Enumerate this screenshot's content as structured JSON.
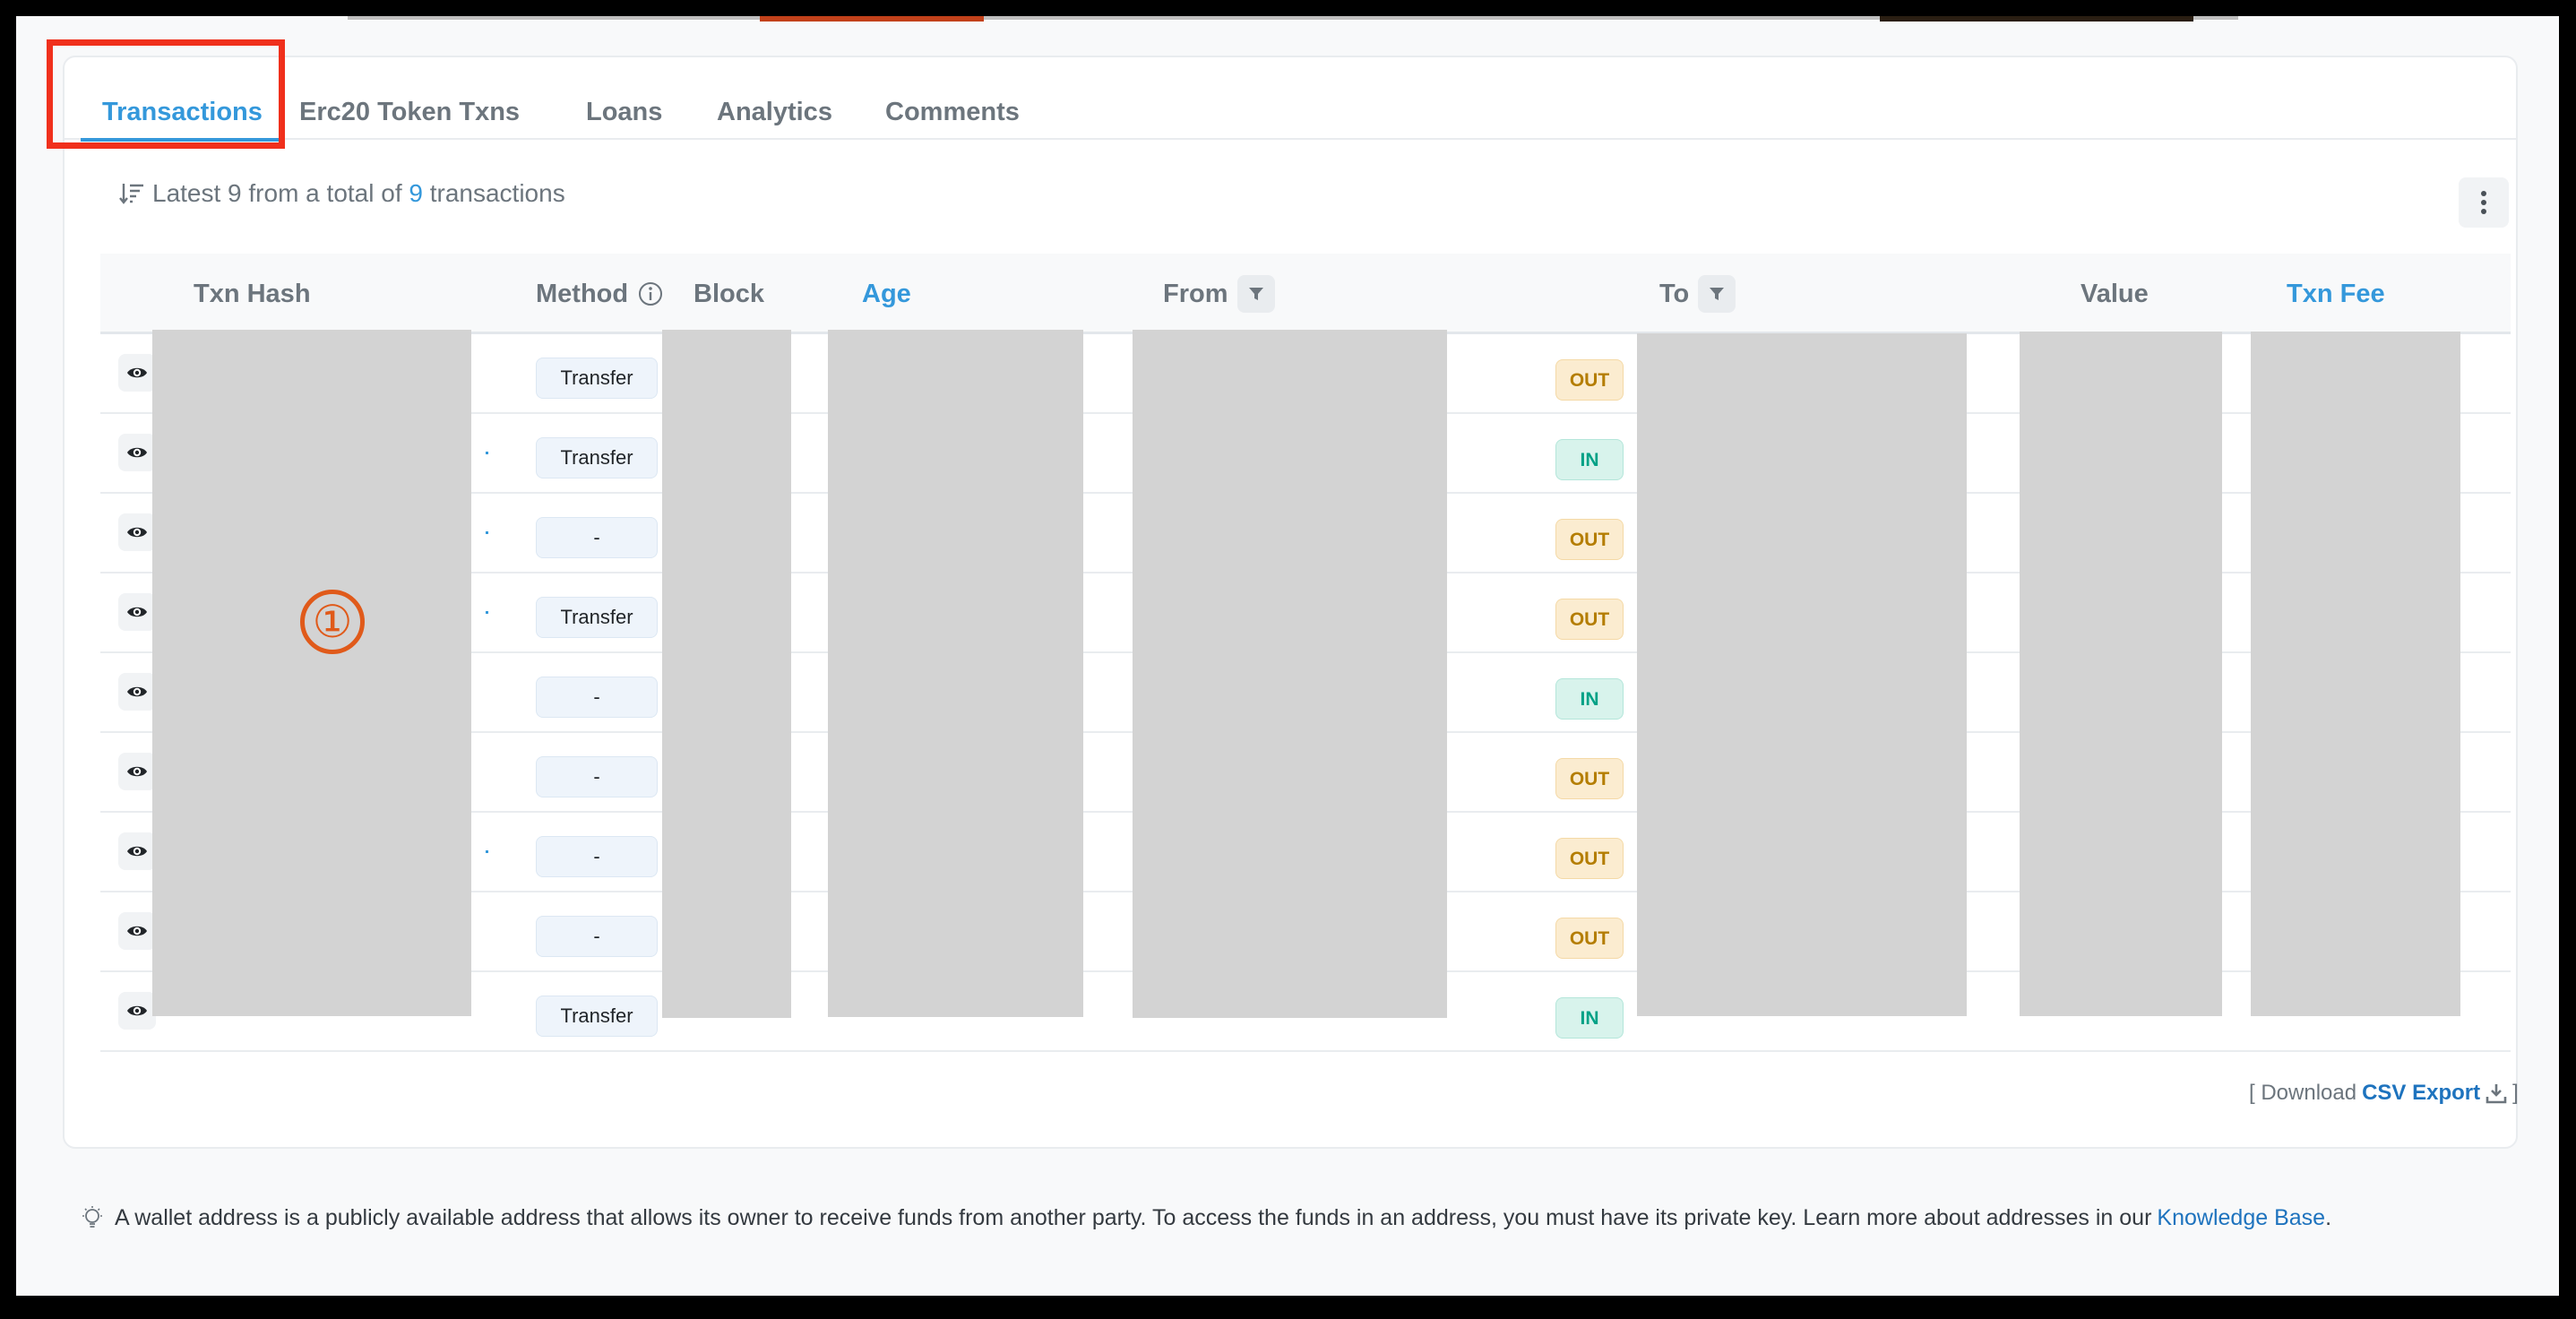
{
  "tabs": [
    {
      "label": "Transactions",
      "active": true
    },
    {
      "label": "Erc20 Token Txns",
      "active": false
    },
    {
      "label": "Loans",
      "active": false
    },
    {
      "label": "Analytics",
      "active": false
    },
    {
      "label": "Comments",
      "active": false
    }
  ],
  "summary": {
    "prefix": "Latest 9 from a total of",
    "count": "9",
    "suffix": "transactions"
  },
  "columns": {
    "txn_hash": "Txn Hash",
    "method": "Method",
    "block": "Block",
    "age": "Age",
    "from": "From",
    "to": "To",
    "value": "Value",
    "txn_fee": "Txn Fee"
  },
  "rows": [
    {
      "method": "Transfer",
      "direction": "OUT"
    },
    {
      "method": "Transfer",
      "direction": "IN"
    },
    {
      "method": "-",
      "direction": "OUT"
    },
    {
      "method": "Transfer",
      "direction": "OUT"
    },
    {
      "method": "-",
      "direction": "IN"
    },
    {
      "method": "-",
      "direction": "OUT"
    },
    {
      "method": "-",
      "direction": "OUT"
    },
    {
      "method": "-",
      "direction": "OUT"
    },
    {
      "method": "Transfer",
      "direction": "IN"
    }
  ],
  "annotation_marker": "①",
  "csv": {
    "open": "[ Download",
    "link": "CSV Export",
    "close": "]"
  },
  "footer": {
    "text": "A wallet address is a publicly available address that allows its owner to receive funds from another party. To access the funds in an address, you must have its private key. Learn more about addresses in our",
    "link": "Knowledge Base",
    "end": "."
  },
  "colors": {
    "accent": "#3498db",
    "out_badge": "#b47d00",
    "in_badge": "#00a186",
    "highlight": "#f0301c"
  }
}
